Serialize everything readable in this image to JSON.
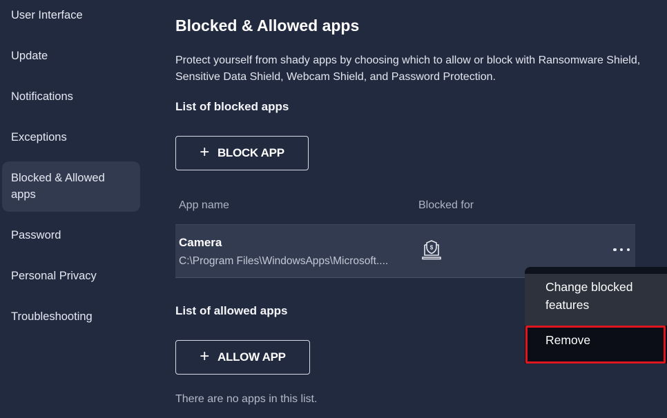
{
  "sidebar": {
    "items": [
      {
        "label": "User Interface",
        "active": false
      },
      {
        "label": "Update",
        "active": false
      },
      {
        "label": "Notifications",
        "active": false
      },
      {
        "label": "Exceptions",
        "active": false
      },
      {
        "label": "Blocked & Allowed apps",
        "active": true
      },
      {
        "label": "Password",
        "active": false
      },
      {
        "label": "Personal Privacy",
        "active": false
      },
      {
        "label": "Troubleshooting",
        "active": false
      }
    ]
  },
  "main": {
    "title": "Blocked & Allowed apps",
    "description": "Protect yourself from shady apps by choosing which to allow or block with Ransomware Shield, Sensitive Data Shield, Webcam Shield, and Password Protection.",
    "blocked_section": {
      "title": "List of blocked apps",
      "button_label": "BLOCK APP",
      "button_icon": "plus-icon",
      "columns": [
        "App name",
        "Blocked for"
      ],
      "rows": [
        {
          "name": "Camera",
          "path": "C:\\Program Files\\WindowsApps\\Microsoft....",
          "blocked_for_icon": "sensitive-data-shield-icon",
          "more_icon": "more-horizontal-icon"
        }
      ]
    },
    "allowed_section": {
      "title": "List of allowed apps",
      "button_label": "ALLOW APP",
      "button_icon": "plus-icon",
      "empty_text": "There are no apps in this list."
    }
  },
  "context_menu": {
    "items": [
      {
        "label": "Change blocked features"
      },
      {
        "label": "Remove",
        "highlighted": true
      }
    ],
    "highlight_color": "#e0161e"
  },
  "colors": {
    "background": "#222a40",
    "row_background": "#333b50",
    "sidebar_active": "#323a4f",
    "menu_background": "#0e121c"
  }
}
